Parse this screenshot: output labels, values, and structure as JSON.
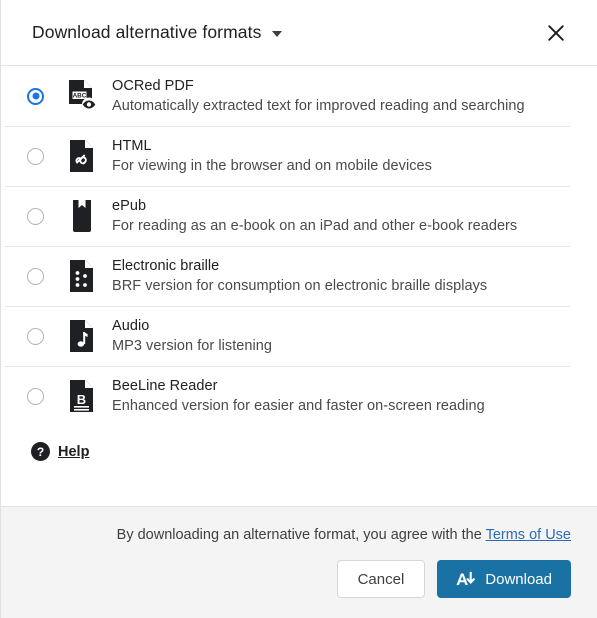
{
  "header": {
    "title": "Download alternative formats",
    "caret_icon": "chevron-down-icon",
    "close_icon": "close-icon"
  },
  "options": [
    {
      "id": "ocred-pdf",
      "title": "OCRed PDF",
      "description": "Automatically extracted text for improved reading and searching",
      "icon": "document-ocr-eye-icon",
      "selected": true
    },
    {
      "id": "html",
      "title": "HTML",
      "description": "For viewing in the browser and on mobile devices",
      "icon": "document-link-icon",
      "selected": false
    },
    {
      "id": "epub",
      "title": "ePub",
      "description": "For reading as an e-book on an iPad and other e-book readers",
      "icon": "bookmark-icon",
      "selected": false
    },
    {
      "id": "electronic-braille",
      "title": "Electronic braille",
      "description": "BRF version for consumption on electronic braille displays",
      "icon": "document-braille-icon",
      "selected": false
    },
    {
      "id": "audio",
      "title": "Audio",
      "description": "MP3 version for listening",
      "icon": "document-music-note-icon",
      "selected": false
    },
    {
      "id": "beeline-reader",
      "title": "BeeLine Reader",
      "description": "Enhanced version for easier and faster on-screen reading",
      "icon": "document-b-icon",
      "selected": false
    }
  ],
  "help": {
    "label": "Help",
    "icon": "help-circle-icon"
  },
  "footer": {
    "terms_text": "By downloading an alternative format, you agree with the",
    "terms_link": "Terms of Use",
    "cancel_label": "Cancel",
    "download_label": "Download",
    "download_icon": "font-download-arrow-icon"
  },
  "colors": {
    "accent_blue": "#1a72a4",
    "radio_selected": "#1a73e8",
    "link_blue": "#2b6cb8",
    "footer_bg": "#f4f4f4",
    "icon_dark": "#1e2023"
  }
}
